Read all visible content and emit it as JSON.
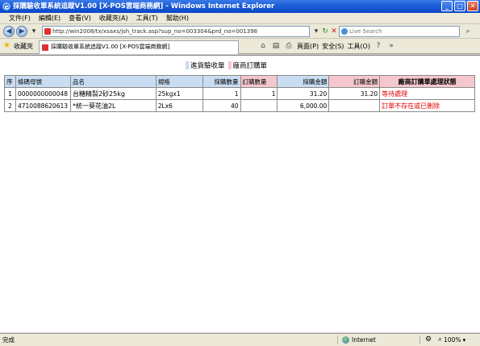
{
  "window": {
    "title": "採購驗收單系統追蹤V1.00 [X-POS雲端商務網] - Windows Internet Explorer",
    "buttons": {
      "minimize": "_",
      "maximize": "□",
      "close": "✕"
    }
  },
  "menu": [
    "文件(F)",
    "編輯(E)",
    "查看(V)",
    "收藏夾(A)",
    "工具(T)",
    "幫助(H)"
  ],
  "address": {
    "url": "http://win2008/tx/xsaxs/jsh_track.asp?sup_no=003304&prd_no=001398",
    "search_placeholder": "Live Search"
  },
  "favorites": {
    "label": "收藏夾"
  },
  "tab": {
    "label": "採購驗收單系統追蹤V1.00 [X-POS雲端商務網]"
  },
  "tools": {
    "page": "頁面(P)",
    "safety": "安全(S)",
    "tools": "工具(O)"
  },
  "legend": [
    {
      "label": "進貨驗收單",
      "color": "#c9ddf2"
    },
    {
      "label": "廠商訂購單",
      "color": "#f4c7cc"
    }
  ],
  "table": {
    "headers": [
      "序",
      "條碼母號",
      "品名",
      "規格",
      "採購數量",
      "訂購數量",
      "採購金額",
      "訂購金額",
      "廠商訂購單處理狀態"
    ],
    "rows": [
      {
        "seq": "1",
        "barcode": "0000000000048",
        "name": "台糖精製2砂25kg",
        "spec": "25kgx1",
        "purchase_qty": "1",
        "order_qty": "1",
        "purchase_amt": "31.20",
        "order_amt": "31.20",
        "status": "等待處理"
      },
      {
        "seq": "2",
        "barcode": "4710088620613",
        "name": "*統一葵花油2L",
        "spec": "2Lx6",
        "purchase_qty": "40",
        "order_qty": "",
        "purchase_amt": "6,000.00",
        "order_amt": "",
        "status": "訂單不存在或已刪除"
      }
    ]
  },
  "status": {
    "text": "完成",
    "zone": "Internet",
    "zoom": "100%"
  },
  "colors": {
    "title_blue": "#0a46c8",
    "header_blue": "#c9ddf2",
    "header_pink": "#f4c7cc",
    "status_red": "#e00000"
  }
}
